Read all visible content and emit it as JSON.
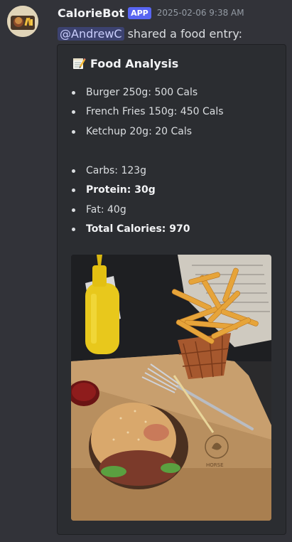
{
  "message": {
    "author": "CalorieBot",
    "badge": "APP",
    "timestamp": "2025-02-06 9:38 AM",
    "mention": "@AndrewC",
    "text": "shared a food entry:"
  },
  "embed": {
    "title": "Food Analysis",
    "title_icon": "memo-icon",
    "foods": [
      "Burger 250g: 500 Cals",
      "French Fries 150g: 450 Cals",
      "Ketchup 20g: 20 Cals"
    ],
    "nutrition": [
      {
        "text": "Carbs: 123g",
        "bold": false
      },
      {
        "text": "Protein: 30g",
        "bold": true
      },
      {
        "text": "Fat: 40g",
        "bold": false
      },
      {
        "text": "Total Calories: 970",
        "bold": true
      }
    ],
    "image_label": "food-photo"
  },
  "colors": {
    "background": "#323339",
    "embed_bg": "#2b2d31",
    "mention_bg": "#3c4270",
    "badge": "#5865f2"
  }
}
